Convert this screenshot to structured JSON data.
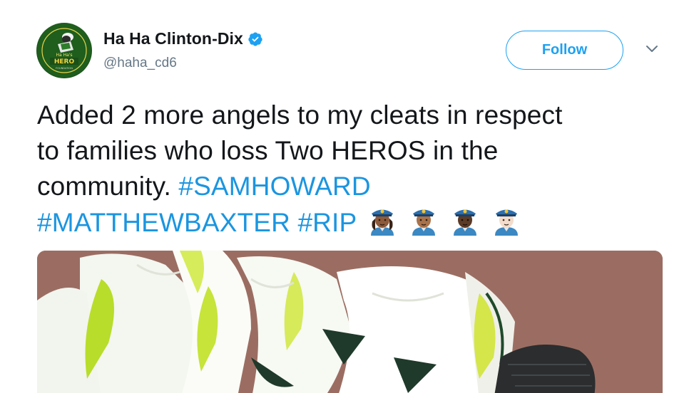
{
  "author": {
    "display_name": "Ha Ha Clinton-Dix",
    "handle": "@haha_cd6",
    "avatar_icon": "hero-foundation-logo-icon",
    "verified_icon": "verified-badge-icon"
  },
  "actions": {
    "follow_label": "Follow",
    "more_icon": "chevron-down-icon"
  },
  "tweet": {
    "line1": "Added 2 more angels to my cleats in respect",
    "line2": "to families who loss Two HEROS in the",
    "line3_text": "community. ",
    "hashtag1": "#SAMHOWARD",
    "hashtag2": "#MATTHEWBAXTER",
    "hashtag3": "#RIP",
    "emoji_icons": [
      "police-officer-woman-medium-dark-icon",
      "police-officer-medium-icon",
      "police-officer-dark-icon",
      "police-officer-light-icon"
    ]
  },
  "media": {
    "photo_icon": "cleats-photo-icon"
  },
  "colors": {
    "accent": "#1da1f2",
    "hashtag": "#1b95e0",
    "text": "#14171a",
    "secondary": "#657786"
  }
}
